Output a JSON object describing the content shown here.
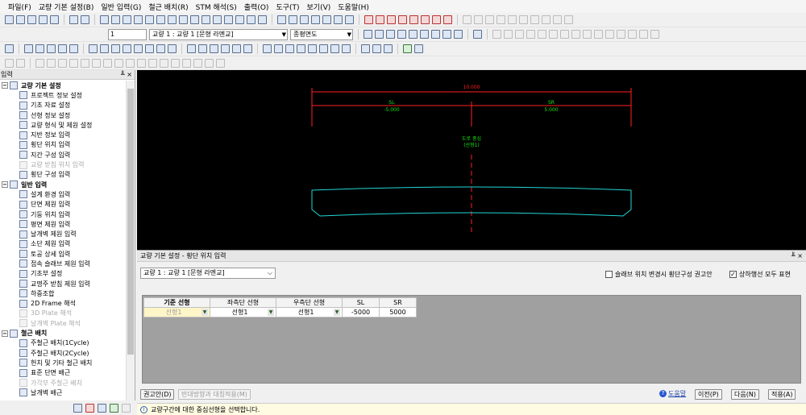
{
  "menu": [
    "파일(F)",
    "교량 기본 설정(B)",
    "일반 입력(G)",
    "철근 배치(R)",
    "STM 해석(S)",
    "출력(O)",
    "도구(T)",
    "보기(V)",
    "도움말(H)"
  ],
  "toolbar2": {
    "number_value": "1",
    "bridge_select": "교량 1 : 교량 1 [문형 라멘교]",
    "view_select": "종평면도"
  },
  "left_panel": {
    "title": "입력",
    "pins": "ᅟ ╨ ×",
    "groups": [
      {
        "label": "교량 기본 설정",
        "items": [
          {
            "label": "프로젝트 정보 설정",
            "disabled": false
          },
          {
            "label": "기초 자료 설정",
            "disabled": false
          },
          {
            "label": "선형 정보 설정",
            "disabled": false
          },
          {
            "label": "교량 형식 및 제원 설정",
            "disabled": false
          },
          {
            "label": "지반 정보 입력",
            "disabled": false
          },
          {
            "label": "횡단 위치 입력",
            "disabled": false
          },
          {
            "label": "지간 구성 입력",
            "disabled": false
          },
          {
            "label": "교량 받침 위치 입력",
            "disabled": true
          },
          {
            "label": "횡단 구성 입력",
            "disabled": false
          }
        ]
      },
      {
        "label": "일반 입력",
        "items": [
          {
            "label": "설계 환경 입력",
            "disabled": false
          },
          {
            "label": "단면 제원 입력",
            "disabled": false
          },
          {
            "label": "기둥 위치 입력",
            "disabled": false
          },
          {
            "label": "평면 제원 입력",
            "disabled": false
          },
          {
            "label": "날개벽 제원 입력",
            "disabled": false
          },
          {
            "label": "소단 제원 입력",
            "disabled": false
          },
          {
            "label": "토공 상세 입력",
            "disabled": false
          },
          {
            "label": "접속 슬래브 제원 입력",
            "disabled": false
          },
          {
            "label": "기초부 설정",
            "disabled": false
          },
          {
            "label": "교명주 받침 제원 입력",
            "disabled": false
          },
          {
            "label": "하중조합",
            "disabled": false
          },
          {
            "label": "2D Frame 해석",
            "disabled": false
          },
          {
            "label": "3D Plate 해석",
            "disabled": true
          },
          {
            "label": "날개벽 Plate 해석",
            "disabled": true
          }
        ]
      },
      {
        "label": "철근 배치",
        "items": [
          {
            "label": "주철근 배치(1Cycle)",
            "disabled": false
          },
          {
            "label": "주철근 배치(2Cycle)",
            "disabled": false
          },
          {
            "label": "헌치 및 기타 철근 배치",
            "disabled": false
          },
          {
            "label": "표준 단면 배근",
            "disabled": false
          },
          {
            "label": "가각부 주철근 배치",
            "disabled": true
          },
          {
            "label": "날개벽 배근",
            "disabled": false
          }
        ]
      }
    ]
  },
  "canvas": {
    "total_width": "10.000",
    "left_label": "SL",
    "left_value": "-5.000",
    "right_label": "SR",
    "right_value": "5.000",
    "center_label": "도로 중심",
    "center_sub": "(선형1)",
    "colors": {
      "dim": "#ff2020",
      "green": "#19e619",
      "slab": "#22d6d6"
    }
  },
  "dialog": {
    "title": "교량 기본 설정 - 횡단 위치 입력",
    "pins": "ᅟ ╨ ×",
    "bridge_select": "교량 1 : 교량 1 [문형 라멘교]",
    "checkbox1": {
      "label": "슬래브 위치 변경시 횡단구성 권고안",
      "checked": false
    },
    "checkbox2": {
      "label": "상하행선 모두 표현",
      "checked": true
    },
    "columns": [
      "기준 선형",
      "좌측단 선형",
      "우측단 선형",
      "SL",
      "SR"
    ],
    "row": {
      "base": "선형1",
      "left": "선형1",
      "right": "선형1",
      "sl": "-5000",
      "sr": "5000"
    },
    "buttons": {
      "recommend": "권고안(D)",
      "reverse": "반대방향과 대칭적용(M)",
      "help": "도움말",
      "prev": "이전(P)",
      "next": "다음(N)",
      "apply": "적용(A)"
    }
  },
  "status": {
    "message": "교량구간에 대한 중심선형을 선택합니다."
  }
}
